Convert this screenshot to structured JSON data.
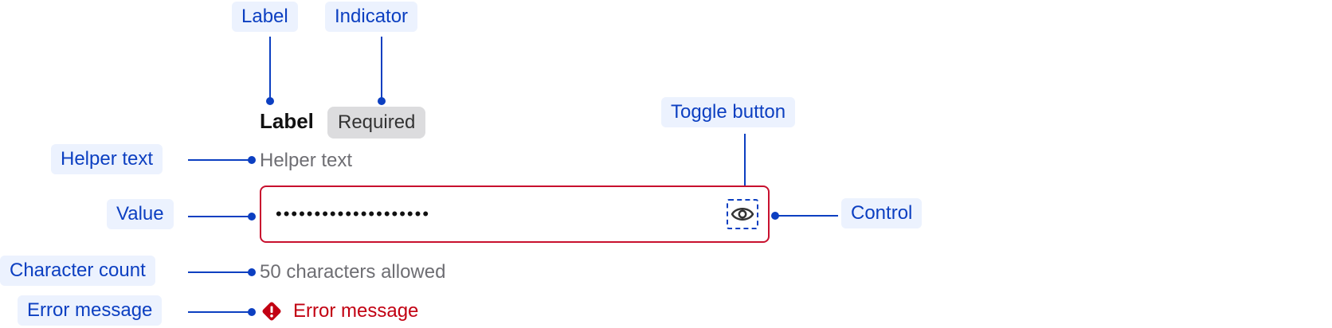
{
  "annotations": {
    "label": "Label",
    "indicator": "Indicator",
    "toggle_button": "Toggle button",
    "helper_text": "Helper text",
    "value": "Value",
    "control": "Control",
    "character_count": "Character count",
    "error_message": "Error message"
  },
  "field": {
    "label": "Label",
    "indicator": "Required",
    "helper_text": "Helper text",
    "value": "••••••••••••••••••••",
    "character_count": "50 characters allowed",
    "error_message": "Error message",
    "toggle_icon": "eye-icon",
    "error_icon": "error-diamond-icon"
  },
  "colors": {
    "annotation": "#0c3fc1",
    "annotation_bg": "#ecf2fe",
    "error": "#c20012",
    "control_border": "#c8102e",
    "indicator_bg": "#dcdcde",
    "muted_text": "#6e6e73"
  }
}
